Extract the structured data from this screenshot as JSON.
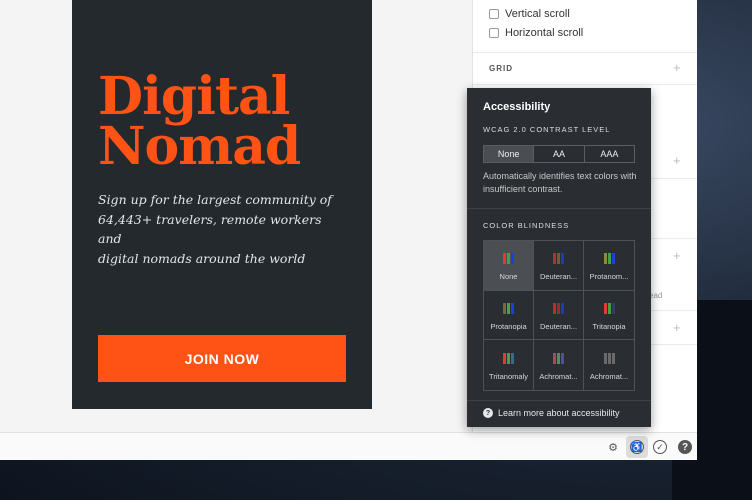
{
  "card": {
    "headline_line1": "Digital",
    "headline_line2": "Nomad",
    "subline_line1": "Sign up for the largest community of",
    "subline_line2": "64,443+ travelers,  remote workers and",
    "subline_line3": "digital nomads around the world",
    "cta_label": "JOIN NOW"
  },
  "panel": {
    "vertical_scroll": "Vertical scroll",
    "horizontal_scroll": "Horizontal scroll",
    "grid_section": "GRID",
    "partial_hint": "ead",
    "plus_glyph": "+"
  },
  "popup": {
    "title": "Accessibility",
    "contrast_label": "WCAG 2.0 CONTRAST LEVEL",
    "contrast_options": [
      "None",
      "AA",
      "AAA"
    ],
    "selected_contrast": "None",
    "contrast_description": "Automatically identifies text colors with insufficient contrast.",
    "color_blindness_label": "COLOR BLINDNESS",
    "modes": [
      {
        "label": "None",
        "selected": true,
        "colors": [
          "#e53935",
          "#43a047",
          "#1e40d8"
        ]
      },
      {
        "label": "Deuteran...",
        "selected": false,
        "colors": [
          "#b52d2d",
          "#7a5a2a",
          "#1e3bb0"
        ]
      },
      {
        "label": "Protanom...",
        "selected": false,
        "colors": [
          "#8a8a3a",
          "#43a047",
          "#1e40d8"
        ]
      },
      {
        "label": "Protanopia",
        "selected": false,
        "colors": [
          "#6b6b4a",
          "#4aa050",
          "#1e40d8"
        ]
      },
      {
        "label": "Deuteran...",
        "selected": false,
        "colors": [
          "#c62828",
          "#9e2a2a",
          "#1e3bb0"
        ]
      },
      {
        "label": "Tritanopia",
        "selected": false,
        "colors": [
          "#e53935",
          "#43a047",
          "#3a3a5a"
        ]
      },
      {
        "label": "Tritanomaly",
        "selected": false,
        "colors": [
          "#e53935",
          "#43a047",
          "#3a6a8a"
        ]
      },
      {
        "label": "Achromat...",
        "selected": false,
        "colors": [
          "#a05050",
          "#50905a",
          "#5050a0"
        ]
      },
      {
        "label": "Achromat...",
        "selected": false,
        "colors": [
          "#6a6a6a",
          "#6a6a6a",
          "#6a6a6a"
        ]
      }
    ],
    "learn_more": "Learn more about accessibility",
    "help_glyph": "?"
  },
  "bottombar": {
    "device_settings_glyph": "⚙",
    "accessibility_glyph": "♿",
    "check_glyph": "✓",
    "help_glyph": "?"
  },
  "colors": {
    "brand_orange": "#ff5316",
    "card_bg": "#24292d",
    "popup_bg": "#2a2d31"
  }
}
